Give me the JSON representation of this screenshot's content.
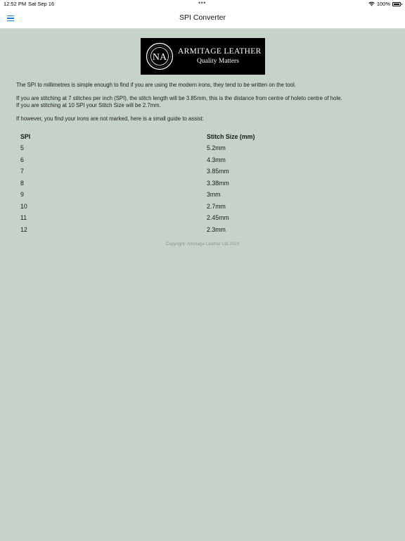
{
  "status_bar": {
    "time": "12:52 PM",
    "date": "Sat Sep 16",
    "battery": "100%",
    "battery_level": 1.0
  },
  "nav": {
    "title": "SPI Converter",
    "menu_icon": "hamburger-menu-icon"
  },
  "logo": {
    "emblem_initials": "NA",
    "name": "ARMITAGE LEATHER",
    "tagline": "Quality Matters"
  },
  "paragraphs": {
    "intro": "The SPI to millimetres is simple enough to find if you are using the modern irons, they tend to be written on the tool.",
    "example_1": "If you are stitching at 7 stitches per inch (SPI), the stitch length will be 3.85mm, this is the distance from centre of holeto centre of hole.",
    "example_2": "If you are stitching at 10 SPI your Stitch Size will be 2.7mm.",
    "guide_intro": "If however, you find your irons are not marked, here is a small guide to assist:"
  },
  "table": {
    "headers": [
      "SPI",
      "Stitch Size (mm)"
    ],
    "rows": [
      [
        "5",
        "5.2mm"
      ],
      [
        "6",
        "4.3mm"
      ],
      [
        "7",
        "3.85mm"
      ],
      [
        "8",
        "3.38mm"
      ],
      [
        "9",
        "3mm"
      ],
      [
        "10",
        "2.7mm"
      ],
      [
        "11",
        "2.45mm"
      ],
      [
        "12",
        "2.3mm"
      ]
    ]
  },
  "footer": {
    "copyright": "Copyright: Armitage Leather Ltd 2023"
  },
  "colors": {
    "background": "#c5d3c9",
    "accent": "#1b7fd6"
  }
}
